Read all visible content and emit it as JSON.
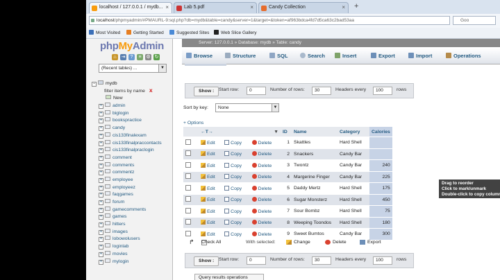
{
  "browser": {
    "tabs": [
      {
        "label": "localhost / 127.0.0.1 / mydb..."
      },
      {
        "label": "Lab 5.pdf"
      },
      {
        "label": "Candy Collection"
      }
    ],
    "new_tab": "+",
    "url_host": "localhost",
    "url_rest": "/phpmyadmin/#PMAURL-9:sql.php?db=mydb&table=candy&server=1&target=&token=af963bdca4fd7d5ca63c2bad53aa",
    "search_placeholder": "Goo",
    "bookmarks": [
      "Most Visited",
      "Getting Started",
      "Suggested Sites",
      "Web Slice Gallery"
    ]
  },
  "nav": {
    "logo_php": "php",
    "logo_my": "My",
    "logo_admin": "Admin",
    "recent": "(Recent tables) ...",
    "db": "mydb",
    "filter": "filter items by name",
    "filter_clear": "X",
    "new": "New",
    "tables": [
      "admin",
      "biglogin",
      "bookspractice",
      "candy",
      "cis133finalexam",
      "cis133finalpraccontacts",
      "cis133finalpraclogin",
      "comment",
      "comments",
      "commentz",
      "employee",
      "employeez",
      "faqgames",
      "forum",
      "gamecomments",
      "games",
      "hitters",
      "images",
      "lobowolusers",
      "loginlab",
      "movies",
      "mylogin"
    ]
  },
  "main": {
    "breadcrumb": "Server: 127.0.0.1  »  Database: mydb  »  Table: candy",
    "tabs": [
      "Browse",
      "Structure",
      "SQL",
      "Search",
      "Insert",
      "Export",
      "Import",
      "Operations"
    ],
    "show": {
      "button": "Show :",
      "start_row_label": "Start row:",
      "start_row": "0",
      "rows_label": "Number of rows:",
      "rows": "30",
      "headers_label": "Headers every",
      "headers": "100",
      "rows_suffix": "rows"
    },
    "sort_label": "Sort by key:",
    "sort_value": "None",
    "options": "+ Options",
    "table": {
      "headers": [
        "←T→",
        "ID",
        "Name",
        "Category",
        "Calories"
      ],
      "actions": {
        "edit": "Edit",
        "copy": "Copy",
        "delete": "Delete"
      },
      "rows": [
        {
          "id": "1",
          "name": "Skattles",
          "category": "Hard Shell",
          "calories": ""
        },
        {
          "id": "2",
          "name": "Snackers",
          "category": "Candy Bar",
          "calories": ""
        },
        {
          "id": "3",
          "name": "Twontz",
          "category": "Candy Bar",
          "calories": "240"
        },
        {
          "id": "4",
          "name": "Margerine Finger",
          "category": "Candy Bar",
          "calories": "225"
        },
        {
          "id": "5",
          "name": "Daddy Mertz",
          "category": "Hard Shell",
          "calories": "175"
        },
        {
          "id": "6",
          "name": "Sugar Monsterz",
          "category": "Hard Shell",
          "calories": "450"
        },
        {
          "id": "7",
          "name": "Sour Bombz",
          "category": "Hard Shell",
          "calories": "75"
        },
        {
          "id": "8",
          "name": "Weeping Toondos",
          "category": "Hard Shell",
          "calories": "180"
        },
        {
          "id": "9",
          "name": "Sweet Bumtos",
          "category": "Candy Bar",
          "calories": "300"
        }
      ]
    },
    "tooltip": [
      "Drag to reorder",
      "Click to mark/unmark",
      "Double-click to copy column name"
    ],
    "footer": {
      "check_all": "Check All",
      "with_selected": "With selected:",
      "change": "Change",
      "delete": "Delete",
      "export": "Export"
    },
    "bottom_button": "Query results operations"
  }
}
